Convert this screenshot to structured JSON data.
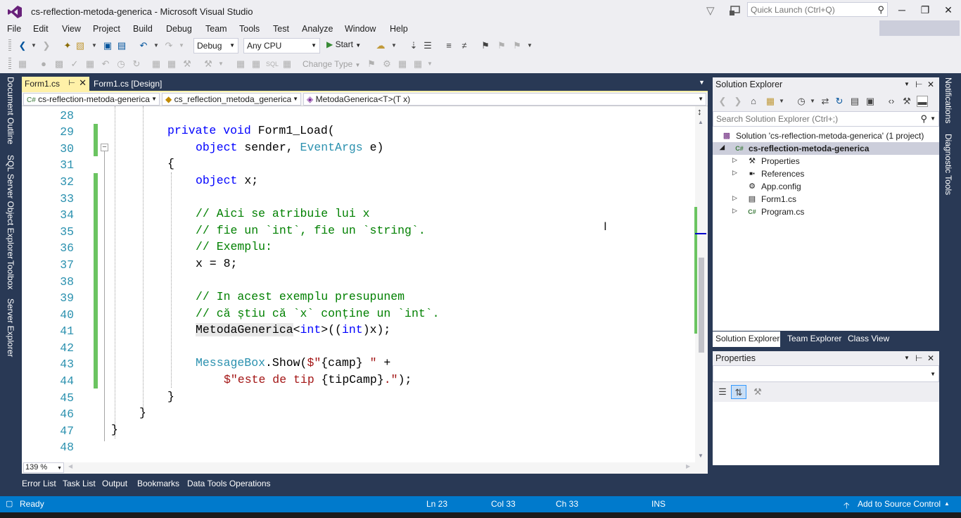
{
  "window": {
    "title": "cs-reflection-metoda-generica - Microsoft Visual Studio",
    "quick_launch_placeholder": "Quick Launch (Ctrl+Q)"
  },
  "menu": [
    "File",
    "Edit",
    "View",
    "Project",
    "Build",
    "Debug",
    "Team",
    "Tools",
    "Test",
    "Analyze",
    "Window",
    "Help"
  ],
  "toolbar": {
    "configuration": "Debug",
    "platform": "Any CPU",
    "start_label": "Start",
    "change_type_label": "Change Type"
  },
  "left_tool_tabs": [
    "Document Outline",
    "SQL Server Object Explorer",
    "Toolbox",
    "Server Explorer"
  ],
  "right_tool_tabs": [
    "Notifications",
    "Diagnostic Tools"
  ],
  "doc_tabs": [
    {
      "label": "Form1.cs",
      "active": true
    },
    {
      "label": "Form1.cs [Design]",
      "active": false
    }
  ],
  "navbar": {
    "project": "cs-reflection-metoda-generica",
    "class": "cs_reflection_metoda_generica",
    "member": "MetodaGenerica<T>(T x)"
  },
  "editor": {
    "line_numbers": [
      "28",
      "29",
      "30",
      "31",
      "32",
      "33",
      "34",
      "35",
      "36",
      "37",
      "38",
      "39",
      "40",
      "41",
      "42",
      "43",
      "44",
      "45",
      "46",
      "47",
      "48"
    ],
    "code": {
      "l29_kw": "private void",
      "l29_rest": " Form1_Load(",
      "l30_kw": "object",
      "l30_a": " sender, ",
      "l30_ty": "EventArgs",
      "l30_b": " e)",
      "l31": "{",
      "l32_kw": "object",
      "l32_rest": " x;",
      "l34": "// Aici se atribuie lui x",
      "l35": "// fie un `int`, fie un `string`.",
      "l36": "// Exemplu:",
      "l37": "x = 8;",
      "l39": "// In acest exemplu presupunem",
      "l40": "// că știu că `x` conține un `int`.",
      "l41_method": "MetodaGenerica",
      "l41_a": "<",
      "l41_kw1": "int",
      "l41_b": ">((",
      "l41_kw2": "int",
      "l41_c": ")x);",
      "l43_ty": "MessageBox",
      "l43_a": ".Show(",
      "l43_str": "$\"",
      "l43_b": "{camp}",
      "l43_str2": " \"",
      "l43_c": " +",
      "l44_str": "$\"este de tip ",
      "l44_b": "{tipCamp}",
      "l44_str2": ".\"",
      "l44_c": ");",
      "l45": "}",
      "l46": "}",
      "l47": "}"
    },
    "zoom": "139 %"
  },
  "bottom_tabs": [
    "Error List",
    "Task List",
    "Output",
    "Bookmarks",
    "Data Tools Operations"
  ],
  "solution_explorer": {
    "title": "Solution Explorer",
    "search_placeholder": "Search Solution Explorer (Ctrl+;)",
    "items": [
      {
        "label": "Solution 'cs-reflection-metoda-generica' (1 project)",
        "icon": "solution-icon"
      },
      {
        "label": "cs-reflection-metoda-generica",
        "icon": "csharp-project-icon",
        "selected": true
      },
      {
        "label": "Properties",
        "icon": "wrench-icon"
      },
      {
        "label": "References",
        "icon": "references-icon"
      },
      {
        "label": "App.config",
        "icon": "config-file-icon"
      },
      {
        "label": "Form1.cs",
        "icon": "form-icon"
      },
      {
        "label": "Program.cs",
        "icon": "csharp-file-icon"
      }
    ],
    "tabs": [
      "Solution Explorer",
      "Team Explorer",
      "Class View"
    ]
  },
  "properties": {
    "title": "Properties"
  },
  "status": {
    "state": "Ready",
    "ln": "Ln 23",
    "col": "Col 33",
    "ch": "Ch 33",
    "mode": "INS",
    "source_control": "Add to Source Control"
  },
  "colors": {
    "accent": "#007acc",
    "active_tab": "#fff1a8",
    "change_bar": "#6bc461",
    "background": "#293955"
  }
}
